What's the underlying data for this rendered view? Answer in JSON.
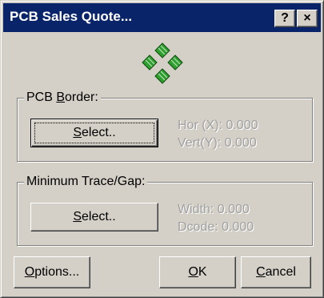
{
  "window": {
    "title": "PCB Sales Quote...",
    "help_label": "?",
    "close_label": "×"
  },
  "pcb_border": {
    "label_prefix": "PCB ",
    "label_mnemonic": "B",
    "label_suffix": "order:",
    "select_mnemonic": "S",
    "select_rest": "elect..",
    "hor": "Hor (X): 0.000",
    "vert": "Vert(Y): 0.000"
  },
  "trace_gap": {
    "label": "Minimum Trace/Gap:",
    "select_mnemonic": "S",
    "select_rest": "elect..",
    "width": "Width: 0.000",
    "dcode": "Dcode: 0.000"
  },
  "buttons": {
    "options_mnemonic": "O",
    "options_rest": "ptions...",
    "ok_mnemonic": "O",
    "ok_rest": "K",
    "cancel_mnemonic": "C",
    "cancel_rest": "ancel"
  },
  "colors": {
    "titlebar": "#0a246a",
    "dialog_face": "#d4d0c8",
    "disabled_text": "#a0a0a0",
    "logo_green": "#2fa02f"
  },
  "icons": {
    "logo": "pcb-chips-icon"
  }
}
